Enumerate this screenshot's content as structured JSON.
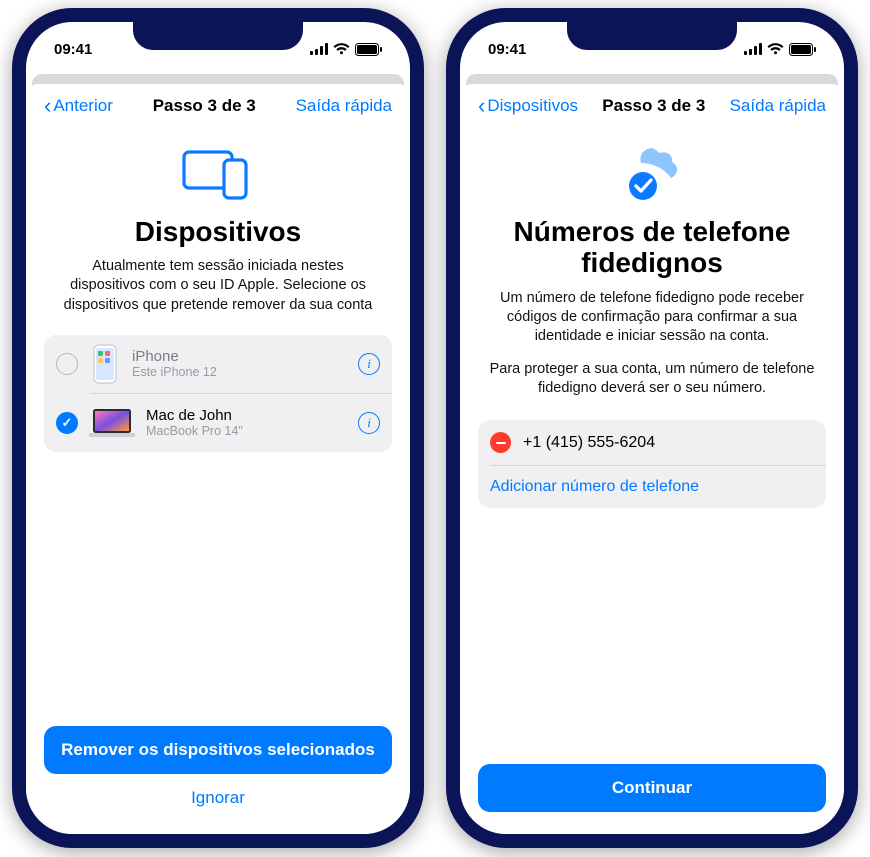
{
  "statusbar": {
    "time": "09:41"
  },
  "left": {
    "nav": {
      "back": "Anterior",
      "title": "Passo 3 de 3",
      "exit": "Saída rápida"
    },
    "page_title": "Dispositivos",
    "subtitle": "Atualmente tem sessão iniciada nestes dispositivos com o seu ID Apple. Selecione os dispositivos que pretende remover da sua conta",
    "devices": [
      {
        "name": "iPhone",
        "sub": "Este iPhone 12",
        "checked": false
      },
      {
        "name": "Mac de John",
        "sub": "MacBook Pro 14\"",
        "checked": true
      }
    ],
    "primary": "Remover os dispositivos selecionados",
    "secondary": "Ignorar"
  },
  "right": {
    "nav": {
      "back": "Dispositivos",
      "title": "Passo 3 de 3",
      "exit": "Saída rápida"
    },
    "page_title": "Números de telefone fidedignos",
    "subtitle": "Um número de telefone fidedigno pode receber códigos de confirmação para confirmar a sua identidade e iniciar sessão na conta.",
    "note": "Para proteger a sua conta, um número de telefone fidedigno deverá ser o seu número.",
    "number": "+1 (415) 555-6204",
    "add_link": "Adicionar número de telefone",
    "primary": "Continuar"
  }
}
